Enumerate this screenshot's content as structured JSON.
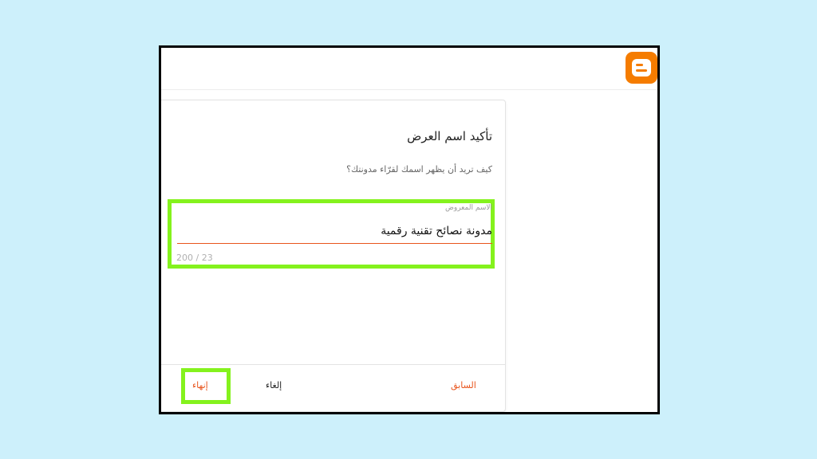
{
  "dialog": {
    "title": "تأكيد اسم العرض",
    "description": "كيف تريد أن يظهر اسمك لقرّاء مدونتك؟",
    "field": {
      "label": "الاسم المعروض",
      "value": "مدونة نصائح تقنية رقمية",
      "counter": "200 / 23"
    },
    "buttons": {
      "finish": "إنهاء",
      "cancel": "إلغاء",
      "back": "السابق"
    }
  },
  "colors": {
    "accent": "#e8541c",
    "highlight": "#84f21d",
    "logo": "#f57c00",
    "background": "#cdf0fb"
  },
  "icons": {
    "logo": "blogger-logo-icon"
  }
}
